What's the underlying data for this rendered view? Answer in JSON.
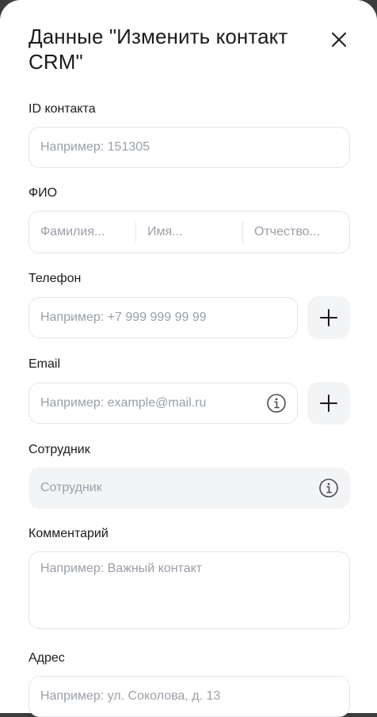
{
  "modal": {
    "title": "Данные \"Изменить контакт CRM\""
  },
  "fields": {
    "contact_id": {
      "label": "ID контакта",
      "placeholder": "Например: 151305"
    },
    "fio": {
      "label": "ФИО",
      "last_name_placeholder": "Фамилия...",
      "first_name_placeholder": "Имя...",
      "middle_name_placeholder": "Отчество..."
    },
    "phone": {
      "label": "Телефон",
      "placeholder": "Например: +7 999 999 99 99"
    },
    "email": {
      "label": "Email",
      "placeholder": "Например: example@mail.ru"
    },
    "employee": {
      "label": "Сотрудник",
      "placeholder": "Сотрудник"
    },
    "comment": {
      "label": "Комментарий",
      "placeholder": "Например: Важный контакт"
    },
    "address": {
      "label": "Адрес",
      "placeholder": "Например: ул. Соколова, д. 13"
    }
  },
  "icons": {
    "close": "close-icon",
    "add": "plus-icon",
    "info": "info-icon"
  },
  "colors": {
    "text": "#1b1b1f",
    "placeholder": "#9aa0a8",
    "border": "#e3e5ea",
    "button_bg": "#f3f4f6"
  }
}
